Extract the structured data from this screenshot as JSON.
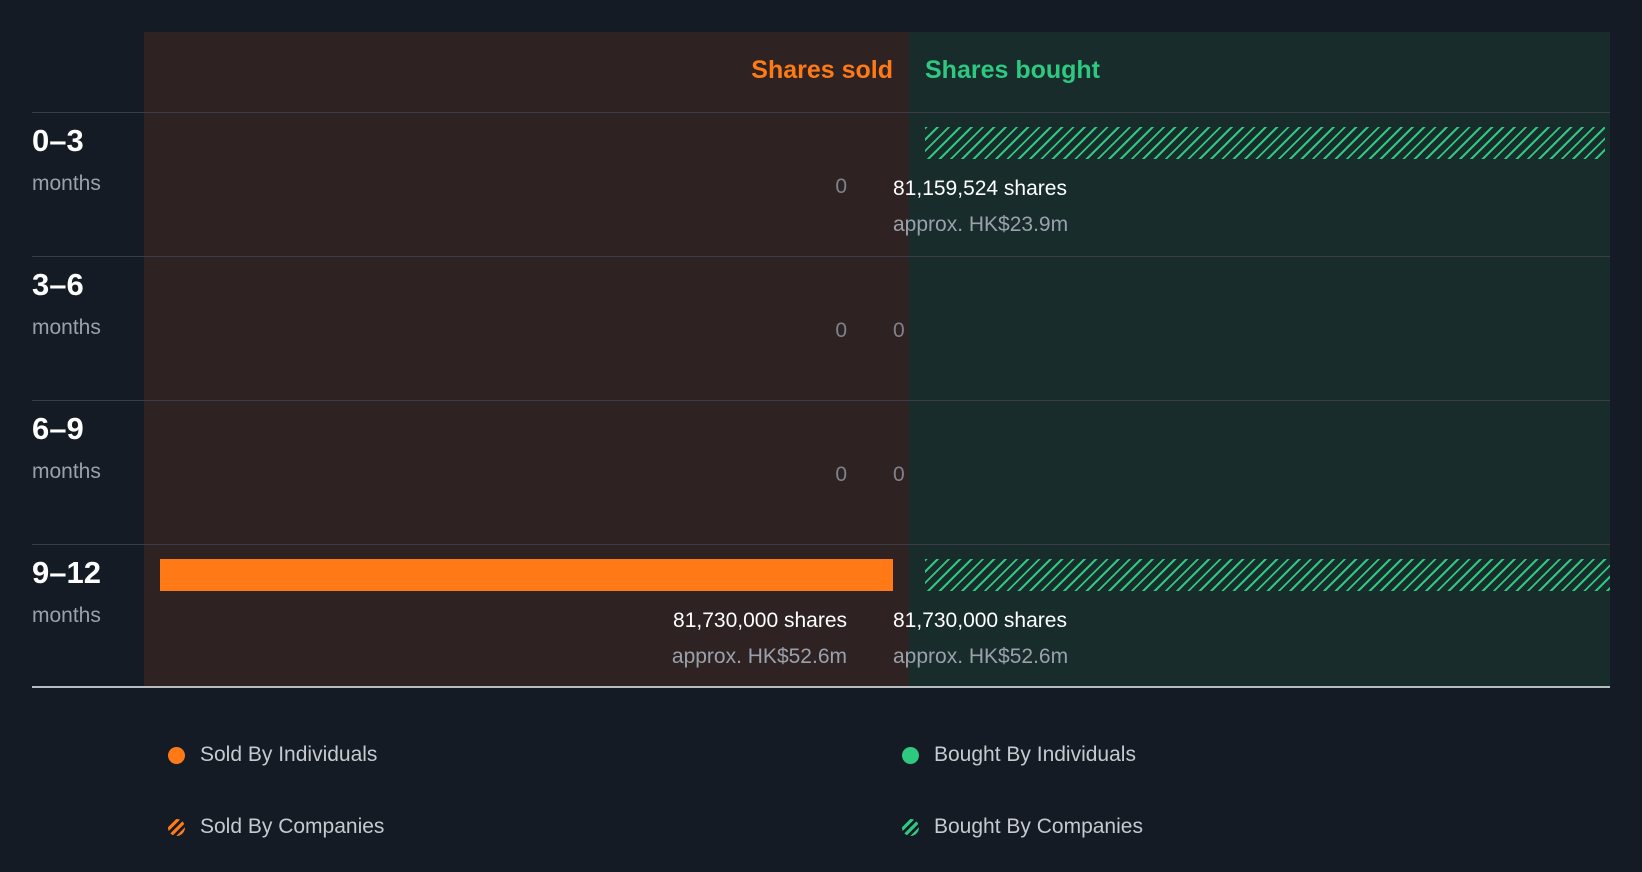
{
  "chart_data": {
    "type": "bar",
    "headers": {
      "sold": "Shares sold",
      "bought": "Shares bought"
    },
    "max_shares": 81730000,
    "rows": [
      {
        "period": "0–3",
        "unit": "months",
        "sold": {
          "shares": 0,
          "label": "0",
          "approx": ""
        },
        "bought": {
          "shares": 81159524,
          "label": "81,159,524 shares",
          "approx": "approx. HK$23.9m",
          "type": "companies"
        }
      },
      {
        "period": "3–6",
        "unit": "months",
        "sold": {
          "shares": 0,
          "label": "0",
          "approx": ""
        },
        "bought": {
          "shares": 0,
          "label": "0",
          "approx": ""
        }
      },
      {
        "period": "6–9",
        "unit": "months",
        "sold": {
          "shares": 0,
          "label": "0",
          "approx": ""
        },
        "bought": {
          "shares": 0,
          "label": "0",
          "approx": ""
        }
      },
      {
        "period": "9–12",
        "unit": "months",
        "sold": {
          "shares": 81730000,
          "label": "81,730,000 shares",
          "approx": "approx. HK$52.6m",
          "type": "individuals"
        },
        "bought": {
          "shares": 81730000,
          "label": "81,730,000 shares",
          "approx": "approx. HK$52.6m",
          "type": "companies"
        }
      }
    ],
    "legend": [
      {
        "label": "Sold By Individuals",
        "marker": "solid",
        "color": "#ff7a17"
      },
      {
        "label": "Bought By Individuals",
        "marker": "solid",
        "color": "#2ec880"
      },
      {
        "label": "Sold By Companies",
        "marker": "hatched",
        "color": "#ff7a17"
      },
      {
        "label": "Bought By Companies",
        "marker": "hatched",
        "color": "#2ec880"
      }
    ],
    "colors": {
      "sold": "#ff7a17",
      "bought": "#2ec880",
      "background": "#151b24"
    }
  }
}
